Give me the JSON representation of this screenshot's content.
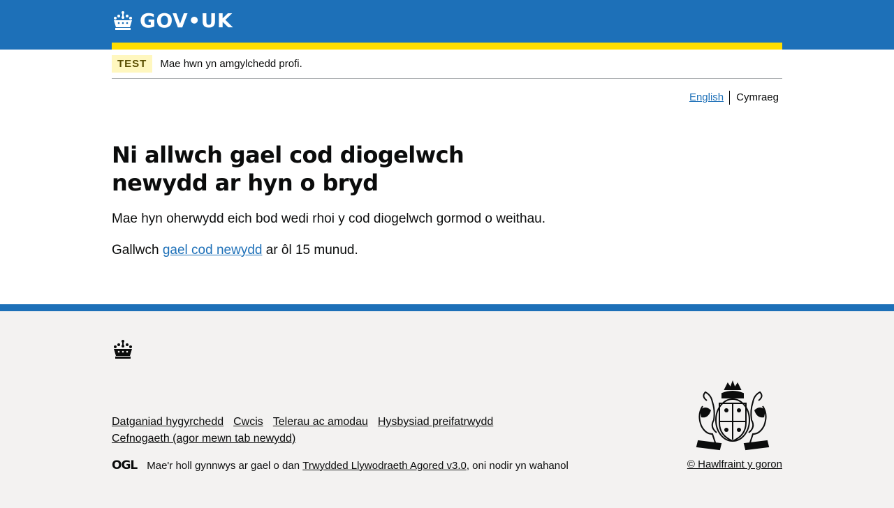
{
  "header": {
    "logo_text": "GOV•UK"
  },
  "phase": {
    "tag": "TEST",
    "text": "Mae hwn yn amgylchedd profi."
  },
  "language": {
    "english": "English",
    "cymraeg": "Cymraeg"
  },
  "main": {
    "heading": "Ni allwch gael cod diogelwch newydd ar hyn o bryd",
    "paragraph1": "Mae hyn oherwydd eich bod wedi rhoi y cod diogelwch gormod o weithau.",
    "paragraph2_prefix": "Gallwch ",
    "paragraph2_link": "gael cod newydd",
    "paragraph2_suffix": " ar ôl 15 munud."
  },
  "footer": {
    "links": [
      "Datganiad hygyrchedd",
      "Cwcis",
      "Telerau ac amodau",
      "Hysbysiad preifatrwydd",
      "Cefnogaeth (agor mewn tab newydd)"
    ],
    "ogl": "OGL",
    "licence_prefix": "Mae'r holl gynnwys ar gael o dan ",
    "licence_link": "Trwydded Llywodraeth Agored v3.0",
    "licence_suffix": ", oni nodir yn wahanol",
    "copyright": "© Hawlfraint y goron"
  },
  "colors": {
    "brand_blue": "#1d70b8",
    "yellow": "#ffdd00",
    "footer_bg": "#f3f2f1",
    "text": "#0b0c0c"
  }
}
